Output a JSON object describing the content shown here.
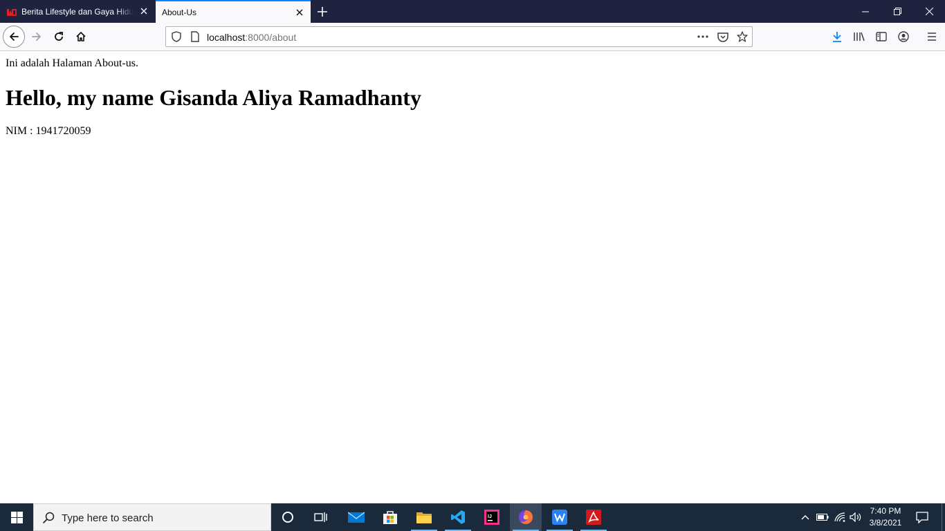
{
  "browser": {
    "tabs": [
      {
        "title": "Berita Lifestyle dan Gaya Hidup",
        "favicon": "tempo-logo-icon",
        "active": false
      },
      {
        "title": "About-Us",
        "favicon": "",
        "active": true
      }
    ],
    "url": {
      "host": "localhost",
      "rest": ":8000/about"
    },
    "colors": {
      "tabstrip": "#202340",
      "accent": "#0a84ff",
      "favicon": "#e11d26"
    }
  },
  "page": {
    "intro": "Ini adalah Halaman About-us.",
    "heading": "Hello, my name Gisanda Aliya Ramadhanty",
    "nim": "NIM : 1941720059"
  },
  "taskbar": {
    "search_placeholder": "Type here to search",
    "apps": [
      "cortana-icon",
      "task-view-icon",
      "mail-icon",
      "store-icon",
      "file-explorer-icon",
      "vscode-icon",
      "intellij-icon",
      "firefox-icon",
      "wps-writer-icon",
      "acrobat-icon"
    ],
    "time": "7:40 PM",
    "date": "3/8/2021",
    "color": "#1b2a3a"
  }
}
